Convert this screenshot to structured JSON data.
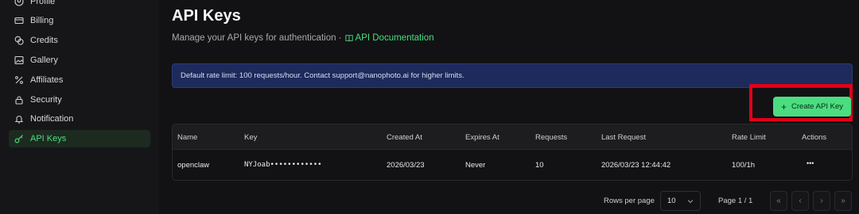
{
  "sidebar": {
    "items": [
      {
        "label": "Profile",
        "icon": "user-circle-icon"
      },
      {
        "label": "Billing",
        "icon": "credit-card-icon"
      },
      {
        "label": "Credits",
        "icon": "coins-icon"
      },
      {
        "label": "Gallery",
        "icon": "image-icon"
      },
      {
        "label": "Affiliates",
        "icon": "percent-icon"
      },
      {
        "label": "Security",
        "icon": "lock-icon"
      },
      {
        "label": "Notification",
        "icon": "bell-icon"
      },
      {
        "label": "API Keys",
        "icon": "key-icon",
        "active": true
      }
    ]
  },
  "header": {
    "title": "API Keys",
    "subtitle": "Manage your API keys for authentication ·",
    "doc_link": "API Documentation"
  },
  "banner": {
    "text": "Default rate limit: 100 requests/hour. Contact support@nanophoto.ai for higher limits."
  },
  "actions": {
    "create_label": "Create API Key"
  },
  "table": {
    "columns": [
      "Name",
      "Key",
      "Created At",
      "Expires At",
      "Requests",
      "Last Request",
      "Rate Limit",
      "Actions"
    ],
    "rows": [
      {
        "name": "openclaw",
        "key": "NYJoab••••••••••••",
        "created_at": "2026/03/23",
        "expires_at": "Never",
        "requests": "10",
        "last_request": "2026/03/23 12:44:42",
        "rate_limit": "100/1h",
        "actions": "•••"
      }
    ]
  },
  "pagination": {
    "rows_per_page_label": "Rows per page",
    "rows_per_page_value": "10",
    "page_label": "Page 1 / 1",
    "first": "«",
    "prev": "‹",
    "next": "›",
    "last": "»"
  },
  "colors": {
    "accent": "#4ade80",
    "banner_bg": "#1d2a5b",
    "highlight": "#e0001b"
  }
}
